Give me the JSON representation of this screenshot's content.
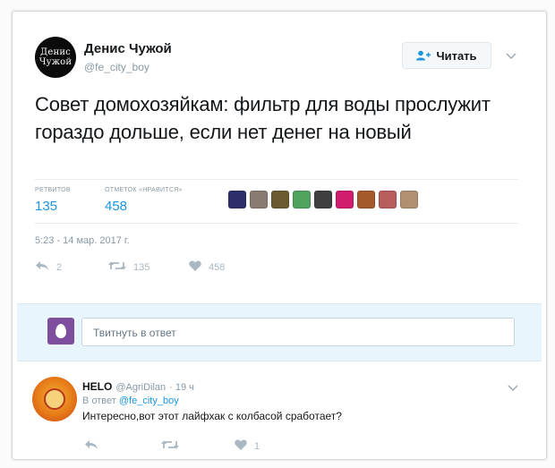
{
  "tweet": {
    "author": {
      "avatar_line1": "Денис",
      "avatar_line2": "Чужой",
      "fullname": "Денис Чужой",
      "username": "@fe_city_boy"
    },
    "follow_label": "Читать",
    "text": "Совет домохозяйкам: фильтр для воды прослужит гораздо дольше, если нет денег на новый",
    "stats": {
      "retweets_label": "РЕТВИТОВ",
      "retweets_value": "135",
      "likes_label": "ОТМЕТОК «НРАВИТСЯ»",
      "likes_value": "458"
    },
    "likers": [
      {
        "color": "#2d2f6b"
      },
      {
        "color": "#8a7b72"
      },
      {
        "color": "#6b5a2f"
      },
      {
        "color": "#4fa35e"
      },
      {
        "color": "#3f3f3f"
      },
      {
        "color": "#d11d6e"
      },
      {
        "color": "#a45a2a"
      },
      {
        "color": "#b85c5c"
      },
      {
        "color": "#b09070"
      }
    ],
    "timestamp": "5:23 - 14 мар. 2017 г.",
    "actions": {
      "reply_count": "2",
      "retweet_count": "135",
      "like_count": "458"
    }
  },
  "reply_composer": {
    "placeholder": "Твитнуть в ответ"
  },
  "reply": {
    "fullname": "HELO",
    "username": "@AgriDilan",
    "time": "· 19 ч",
    "in_reply_prefix": "В ответ",
    "in_reply_handle": "@fe_city_boy",
    "text": "Интересно,вот этот лайфхак  с колбасой сработает?",
    "like_count": "1"
  },
  "colors": {
    "accent": "#1b95e0",
    "muted": "#8899a6",
    "composer_bg": "#e8f5fd"
  }
}
